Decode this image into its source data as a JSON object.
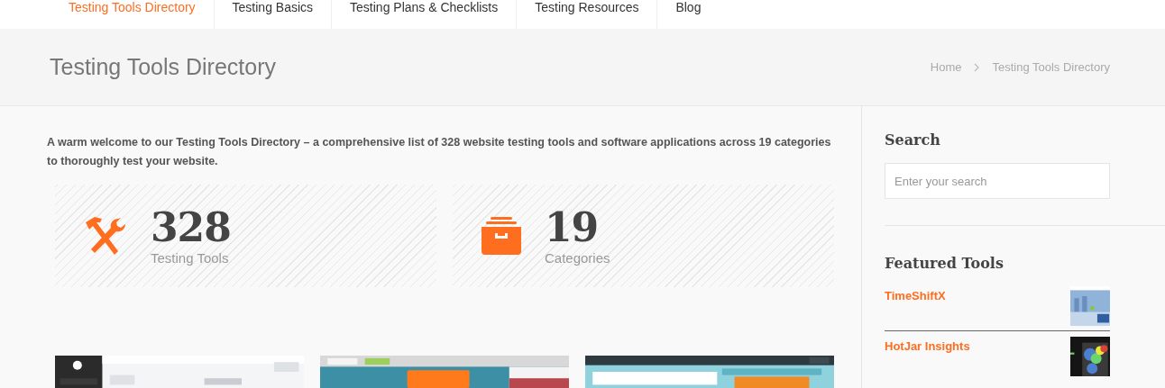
{
  "nav": {
    "items": [
      {
        "label": "Testing Tools Directory",
        "selected": true
      },
      {
        "label": "Testing Basics",
        "selected": false
      },
      {
        "label": "Testing Plans & Checklists",
        "selected": false
      },
      {
        "label": "Testing Resources",
        "selected": false
      },
      {
        "label": "Blog",
        "selected": false
      }
    ]
  },
  "header": {
    "title": "Testing Tools Directory",
    "breadcrumb": [
      {
        "label": "Home"
      },
      {
        "label": "Testing Tools Directory"
      }
    ]
  },
  "intro": "A warm welcome to our Testing Tools Directory – a comprehensive list of 328 website testing tools and software applications across 19 categories to thoroughly test your website.",
  "stats": [
    {
      "value": "328",
      "label": "Testing Tools"
    },
    {
      "value": "19",
      "label": "Categories"
    }
  ],
  "sidebar": {
    "search": {
      "heading": "Search",
      "placeholder": "Enter your search"
    },
    "featured": {
      "heading": "Featured Tools",
      "items": [
        {
          "name": "TimeShiftX"
        },
        {
          "name": "HotJar Insights"
        }
      ]
    }
  }
}
